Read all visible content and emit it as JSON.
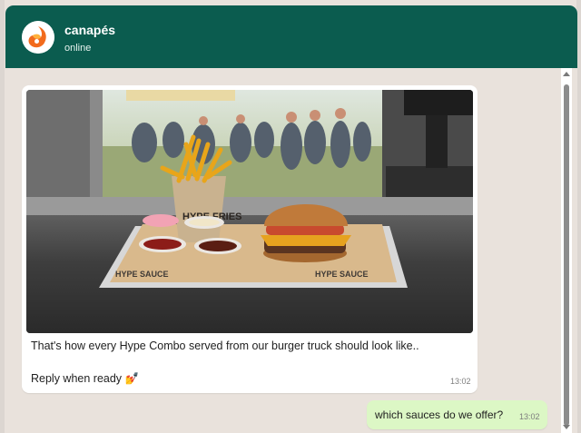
{
  "contact": {
    "name": "canapés",
    "status": "online"
  },
  "messages": [
    {
      "direction": "incoming",
      "image_alt": "Burger combo on a tray",
      "image_text": {
        "cup_label": "HYPE FRIES",
        "paper_label": "HYPE SAUCE"
      },
      "line1": "That's how every Hype Combo served from our burger truck should look like..",
      "line2": "Reply when ready",
      "emoji": "💅",
      "time": "13:02"
    },
    {
      "direction": "outgoing",
      "text": "which sauces do we offer?",
      "time": "13:02"
    }
  ],
  "colors": {
    "header": "#0b5c4f",
    "chat_background": "#e9e2dc",
    "incoming_bubble": "#ffffff",
    "outgoing_bubble": "#dcf7c5"
  }
}
